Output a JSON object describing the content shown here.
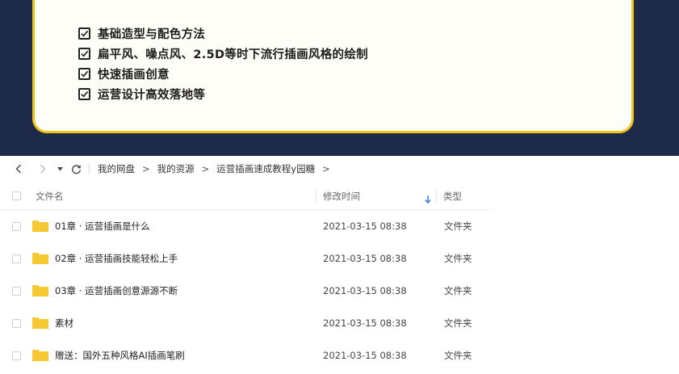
{
  "banner": {
    "features": [
      "基础造型与配色方法",
      "扁平风、噪点风、2.5D等时下流行插画风格的绘制",
      "快速插画创意",
      "运营设计高效落地等"
    ],
    "colors": {
      "background": "#1e2a4a",
      "card": "#fffdf7",
      "border": "#f2c31b"
    }
  },
  "nav": {
    "breadcrumb": [
      "我的网盘",
      "我的资源",
      "运营插画速成教程y园糖"
    ],
    "separator": ">"
  },
  "table": {
    "headers": {
      "name": "文件名",
      "time": "修改时间",
      "type": "类型"
    },
    "sort_icon": "arrow-down-icon",
    "rows": [
      {
        "name": "01章 · 运营插画是什么",
        "time": "2021-03-15 08:38",
        "type": "文件夹"
      },
      {
        "name": "02章 · 运营插画技能轻松上手",
        "time": "2021-03-15 08:38",
        "type": "文件夹"
      },
      {
        "name": "03章 · 运营插画创意源源不断",
        "time": "2021-03-15 08:38",
        "type": "文件夹"
      },
      {
        "name": "素材",
        "time": "2021-03-15 08:38",
        "type": "文件夹"
      },
      {
        "name": "赠送：国外五种风格AI插画笔刷",
        "time": "2021-03-15 08:38",
        "type": "文件夹"
      }
    ],
    "folder_color": "#f6c934",
    "accent_color": "#2f7de1"
  }
}
